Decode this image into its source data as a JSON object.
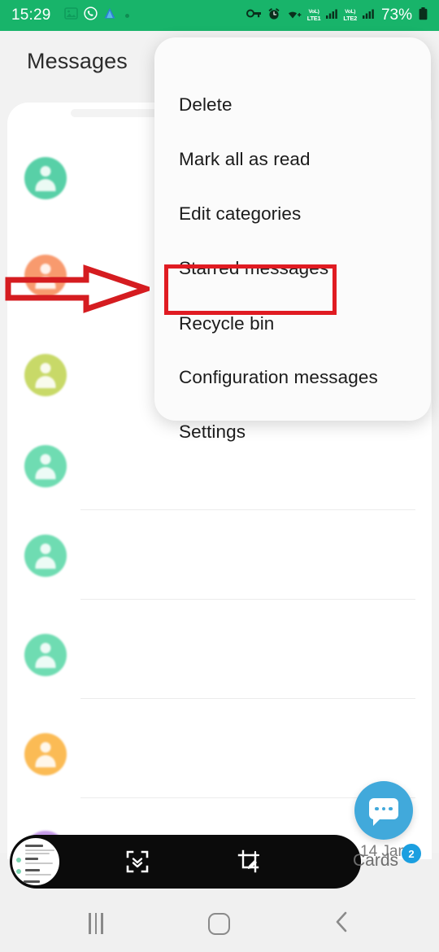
{
  "status_bar": {
    "time": "15:29",
    "left_icons": [
      "gallery-icon",
      "whatsapp-icon",
      "app-icon",
      "dot-indicator"
    ],
    "right_icons": [
      "vpn-key-icon",
      "alarm-icon",
      "wifi-icon"
    ],
    "network": [
      {
        "label_top": "VoL)",
        "label_bottom": "LTE1",
        "signal_icon": "signal-bars-icon"
      },
      {
        "label_top": "VoL)",
        "label_bottom": "LTE2",
        "signal_icon": "signal-bars-icon"
      }
    ],
    "battery_percent": "73%",
    "battery_icon": "battery-full-icon",
    "background_color": "#18b46a"
  },
  "app": {
    "title": "Messages",
    "background_color": "#f2f2f2",
    "conversations": [
      {
        "avatar_color": "#58d0a7"
      },
      {
        "avatar_color": "#f89a6e"
      },
      {
        "avatar_color": "#c8d968"
      },
      {
        "avatar_color": "#6fdcb2"
      },
      {
        "avatar_color": "#6fdcb2"
      },
      {
        "avatar_color": "#6fdcb2"
      },
      {
        "avatar_color": "#fbbb55"
      },
      {
        "avatar_color": "#c59ae8"
      }
    ]
  },
  "fab": {
    "icon": "new-message-bubble-icon",
    "color": "#41a9db",
    "date_label": "14 Jan"
  },
  "overflow_menu": {
    "items": [
      {
        "label": "Delete",
        "highlighted": false
      },
      {
        "label": "Mark all as read",
        "highlighted": false
      },
      {
        "label": "Edit categories",
        "highlighted": false
      },
      {
        "label": "Starred messages",
        "highlighted": false
      },
      {
        "label": "Recycle bin",
        "highlighted": true
      },
      {
        "label": "Configuration messages",
        "highlighted": false
      },
      {
        "label": "Settings",
        "highlighted": false
      }
    ],
    "background_color": "#fbfbfb"
  },
  "annotations": {
    "highlight_color": "#e01b22",
    "arrow": {
      "icon": "right-arrow-annotation",
      "points_to": "Recycle bin"
    },
    "box": {
      "icon": "highlight-rectangle-annotation",
      "target": "Recycle bin"
    }
  },
  "screenshot_toolbar": {
    "thumbnail_icon": "screenshot-thumbnail",
    "buttons": [
      {
        "icon": "scroll-capture-icon"
      },
      {
        "icon": "crop-edit-icon"
      }
    ],
    "background_color": "#0b0b0b"
  },
  "cards": {
    "label": "Cards",
    "badge_count": "2",
    "badge_color": "#1b9fe0"
  },
  "nav_bar": {
    "buttons": [
      {
        "icon": "recents-icon"
      },
      {
        "icon": "home-icon"
      },
      {
        "icon": "back-icon"
      }
    ]
  }
}
